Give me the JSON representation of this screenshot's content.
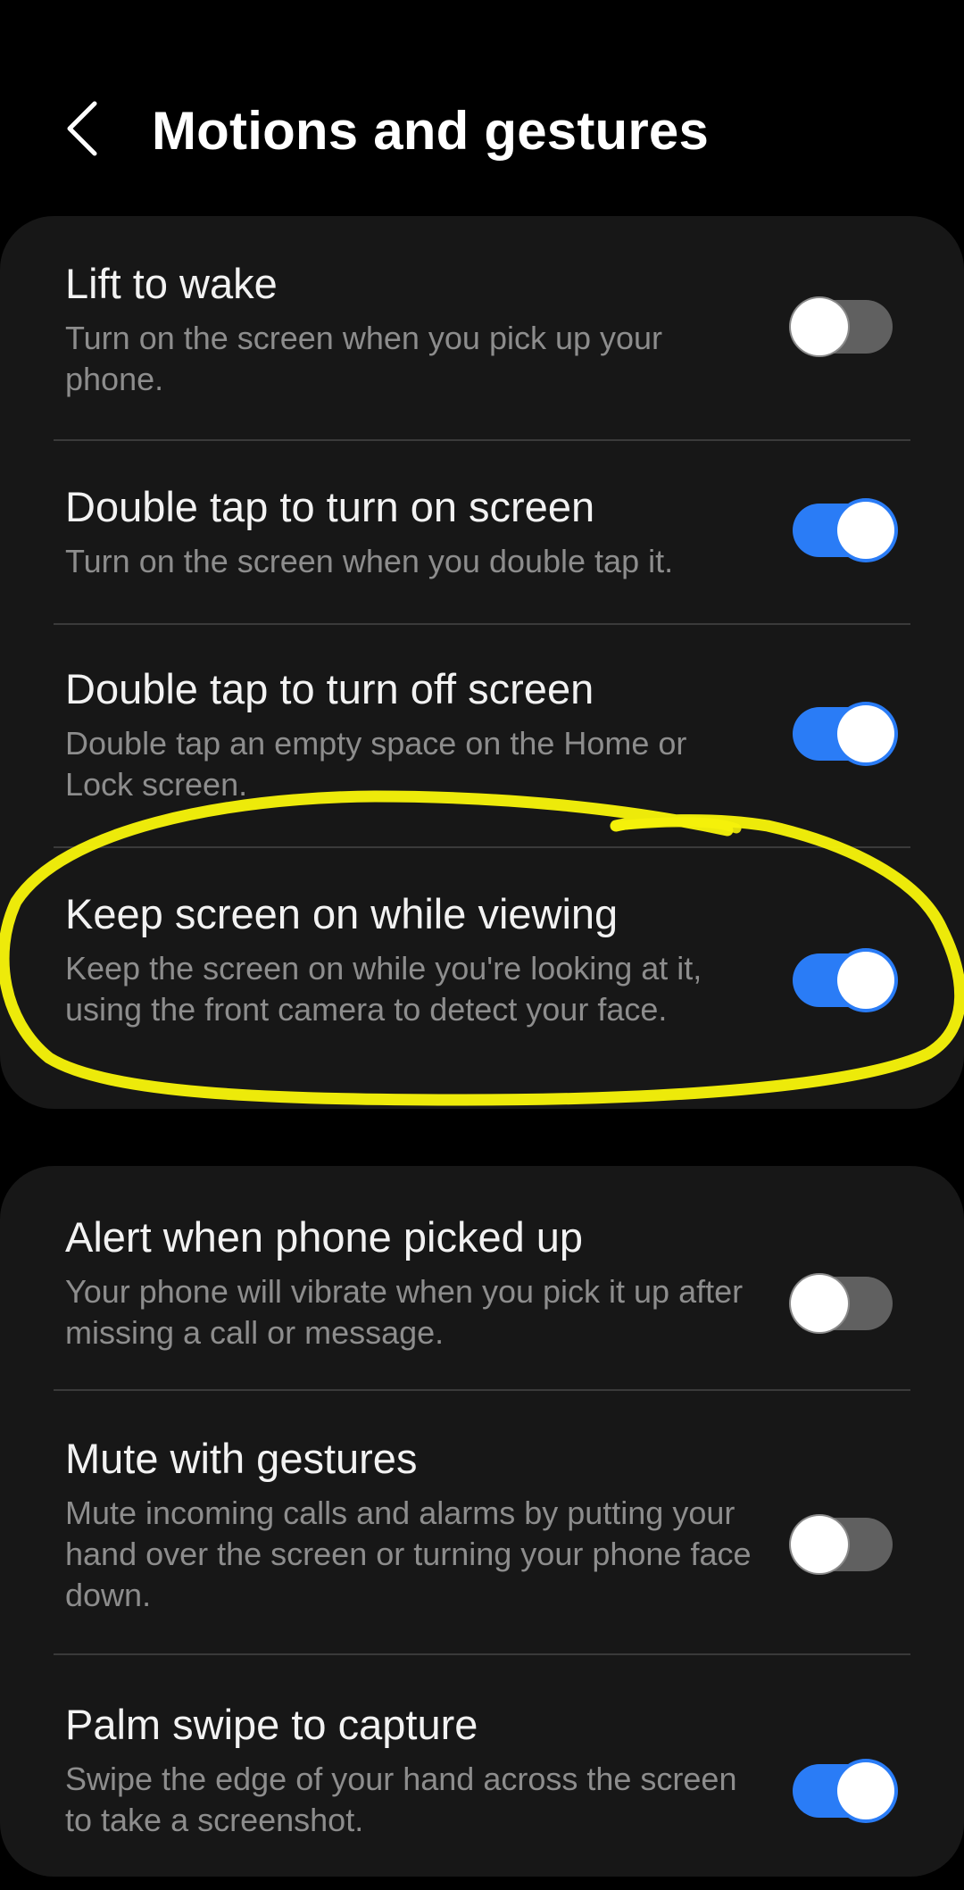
{
  "header": {
    "title": "Motions and gestures",
    "back_icon": "chevron-left-icon"
  },
  "colors": {
    "background": "#000000",
    "card": "#171717",
    "toggle_on": "#2a7cf6",
    "toggle_off": "#606060",
    "annotation": "#f5f20a"
  },
  "groups": [
    {
      "items": [
        {
          "title": "Lift to wake",
          "description": "Turn on the screen when you pick up your phone.",
          "enabled": false
        },
        {
          "title": "Double tap to turn on screen",
          "description": "Turn on the screen when you double tap it.",
          "enabled": true
        },
        {
          "title": "Double tap to turn off screen",
          "description": "Double tap an empty space on the Home or Lock screen.",
          "enabled": true
        },
        {
          "title": "Keep screen on while viewing",
          "description": "Keep the screen on while you're looking at it, using the front camera to detect your face.",
          "enabled": true
        }
      ]
    },
    {
      "items": [
        {
          "title": "Alert when phone picked up",
          "description": "Your phone will vibrate when you pick it up after missing a call or message.",
          "enabled": false
        },
        {
          "title": "Mute with gestures",
          "description": "Mute incoming calls and alarms by putting your hand over the screen or turning your phone face down.",
          "enabled": false
        },
        {
          "title": "Palm swipe to capture",
          "description": "Swipe the edge of your hand across the screen to take a screenshot.",
          "enabled": true
        }
      ]
    }
  ]
}
